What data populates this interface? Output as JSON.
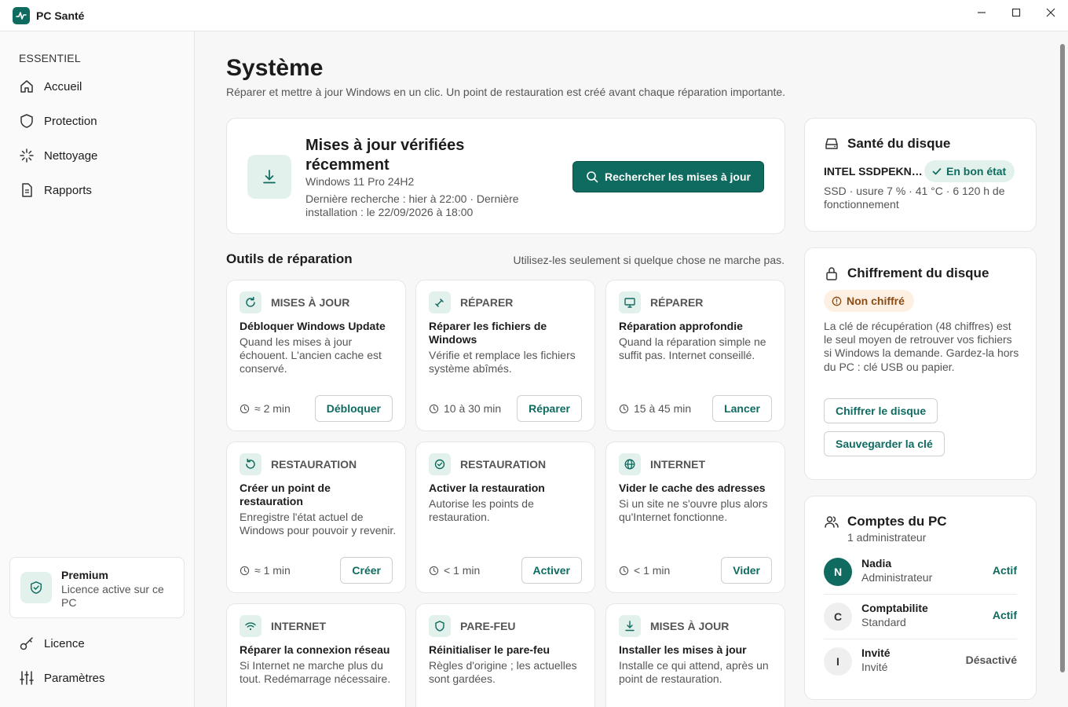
{
  "app": {
    "title": "PC Santé"
  },
  "sidebar": {
    "section": "ESSENTIEL",
    "items": [
      {
        "label": "Accueil",
        "icon": "home-icon"
      },
      {
        "label": "Protection",
        "icon": "shield-icon"
      },
      {
        "label": "Nettoyage",
        "icon": "sparkle-icon"
      },
      {
        "label": "Rapports",
        "icon": "document-icon"
      }
    ],
    "premium": {
      "title": "Premium",
      "subtitle": "Licence active sur ce PC"
    },
    "bottom": [
      {
        "label": "Licence",
        "icon": "key-icon"
      },
      {
        "label": "Paramètres",
        "icon": "sliders-icon"
      }
    ]
  },
  "page": {
    "title": "Système",
    "subtitle": "Réparer et mettre à jour Windows en un clic. Un point de restauration est créé avant chaque réparation importante."
  },
  "updates": {
    "title": "Mises à jour vérifiées récemment",
    "os": "Windows 11 Pro 24H2",
    "last_line1": "Dernière recherche : hier à 22:00 · Dernière",
    "last_line2": "installation : le 22/09/2026 à 18:00",
    "button": "Rechercher les mises à jour"
  },
  "tools": {
    "title": "Outils de réparation",
    "hint": "Utilisez-les seulement si quelque chose ne marche pas.",
    "items": [
      {
        "category": "MISES À JOUR",
        "title": "Débloquer Windows Update",
        "desc": "Quand les mises à jour échouent. L'ancien cache est conservé.",
        "time": "≈ 2 min",
        "button": "Débloquer"
      },
      {
        "category": "RÉPARER",
        "title": "Réparer les fichiers de Windows",
        "desc": "Vérifie et remplace les fichiers système abîmés.",
        "time": "10 à 30 min",
        "button": "Réparer"
      },
      {
        "category": "RÉPARER",
        "title": "Réparation approfondie",
        "desc": "Quand la réparation simple ne suffit pas. Internet conseillé.",
        "time": "15 à 45 min",
        "button": "Lancer"
      },
      {
        "category": "RESTAURATION",
        "title": "Créer un point de restauration",
        "desc": "Enregistre l'état actuel de Windows pour pouvoir y revenir.",
        "time": "≈ 1 min",
        "button": "Créer"
      },
      {
        "category": "RESTAURATION",
        "title": "Activer la restauration",
        "desc": "Autorise les points de restauration.",
        "time": "< 1 min",
        "button": "Activer"
      },
      {
        "category": "INTERNET",
        "title": "Vider le cache des adresses",
        "desc": "Si un site ne s'ouvre plus alors qu'Internet fonctionne.",
        "time": "< 1 min",
        "button": "Vider"
      },
      {
        "category": "INTERNET",
        "title": "Réparer la connexion réseau",
        "desc": "Si Internet ne marche plus du tout. Redémarrage nécessaire.",
        "time": "",
        "button": ""
      },
      {
        "category": "PARE-FEU",
        "title": "Réinitialiser le pare-feu",
        "desc": "Règles d'origine ; les actuelles sont gardées.",
        "time": "",
        "button": ""
      },
      {
        "category": "MISES À JOUR",
        "title": "Installer les mises à jour",
        "desc": "Installe ce qui attend, après un point de restauration.",
        "time": "",
        "button": ""
      }
    ]
  },
  "disk_health": {
    "title": "Santé du disque",
    "model": "INTEL SSDPEKN…",
    "status": "En bon état",
    "details": "SSD · usure 7 % · 41 °C · 6 120 h de fonctionnement"
  },
  "encryption": {
    "title": "Chiffrement du disque",
    "status": "Non chiffré",
    "desc": "La clé de récupération (48 chiffres) est le seul moyen de retrouver vos fichiers si Windows la demande. Gardez-la hors du PC : clé USB ou papier.",
    "encrypt_button": "Chiffrer le disque",
    "save_button": "Sauvegarder la clé"
  },
  "accounts": {
    "title": "Comptes du PC",
    "subtitle": "1 administrateur",
    "items": [
      {
        "initial": "N",
        "name": "Nadia",
        "role": "Administrateur",
        "status": "Actif"
      },
      {
        "initial": "C",
        "name": "Comptabilite",
        "role": "Standard",
        "status": "Actif"
      },
      {
        "initial": "I",
        "name": "Invité",
        "role": "Invité",
        "status": "Désactivé"
      }
    ]
  },
  "colors": {
    "accent": "#0f6b5f",
    "accent_soft": "#e3f1ec",
    "warn_soft": "#fdf0e3",
    "warn_text": "#8a4b14"
  }
}
